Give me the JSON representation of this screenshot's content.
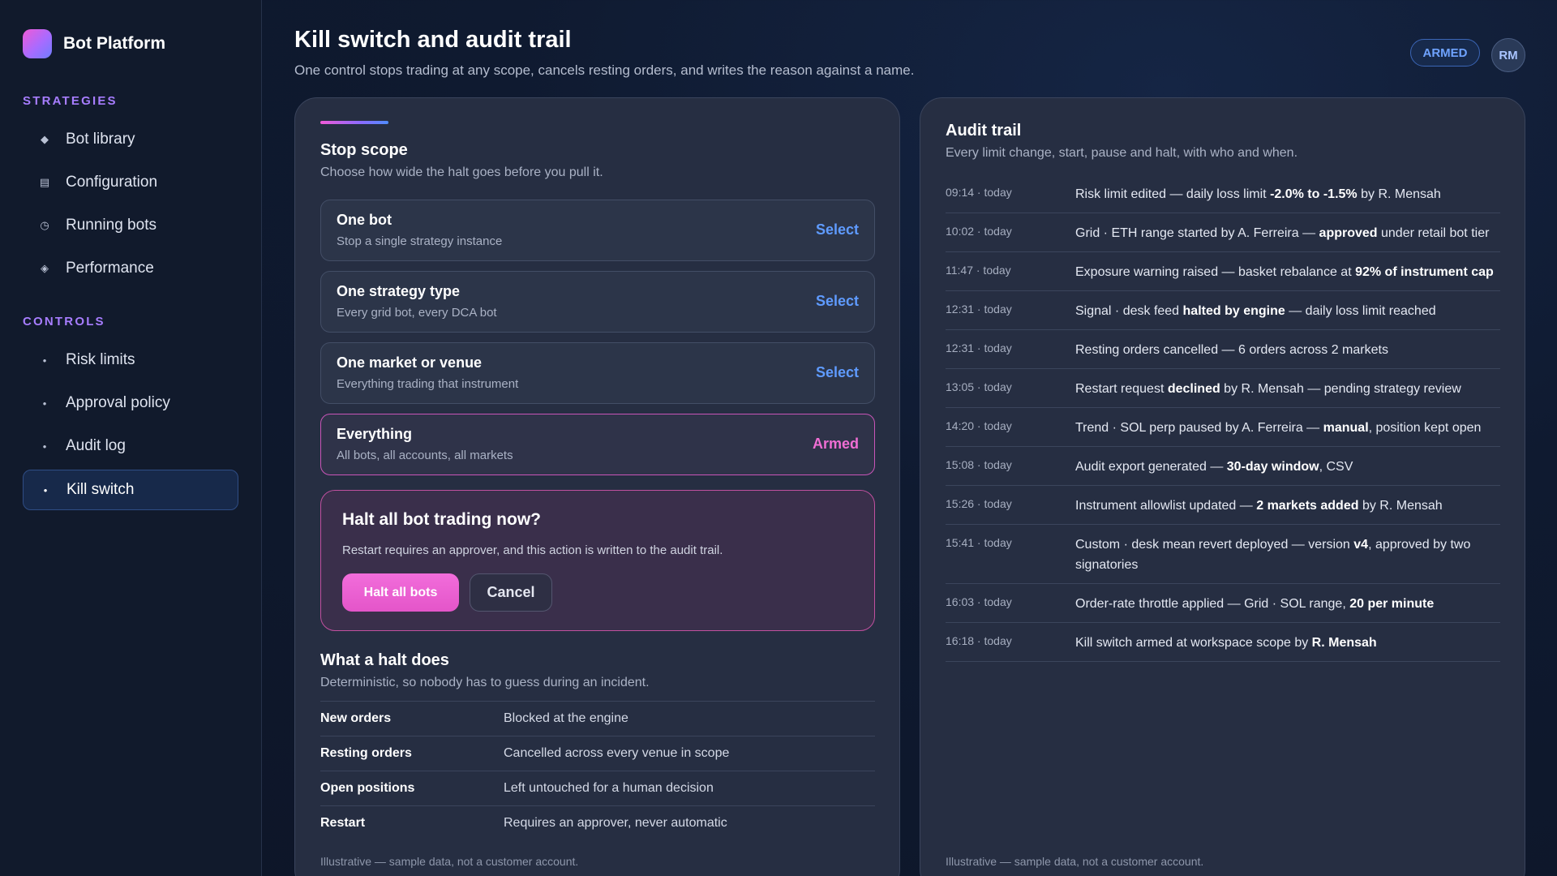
{
  "app": {
    "name": "Bot Platform"
  },
  "sidebar": {
    "sections": [
      {
        "title": "STRATEGIES",
        "items": [
          {
            "label": "Bot library",
            "icon": "diamond-icon",
            "glyph": "◆"
          },
          {
            "label": "Configuration",
            "icon": "list-icon",
            "glyph": "▤"
          },
          {
            "label": "Running bots",
            "icon": "clock-icon",
            "glyph": "◷"
          },
          {
            "label": "Performance",
            "icon": "chart-icon",
            "glyph": "◈"
          }
        ]
      },
      {
        "title": "CONTROLS",
        "items": [
          {
            "label": "Risk limits",
            "icon": "dot-icon",
            "glyph": "•"
          },
          {
            "label": "Approval policy",
            "icon": "dot-icon",
            "glyph": "•"
          },
          {
            "label": "Audit log",
            "icon": "dot-icon",
            "glyph": "•"
          },
          {
            "label": "Kill switch",
            "icon": "dot-icon",
            "glyph": "•",
            "active": true
          }
        ]
      }
    ]
  },
  "header": {
    "title": "Kill switch and audit trail",
    "subtitle": "One control stops trading at any scope, cancels resting orders, and writes the reason against a name.",
    "status_badge": "ARMED",
    "avatar_initials": "RM"
  },
  "stop_scope": {
    "title": "Stop scope",
    "subtitle": "Choose how wide the halt goes before you pull it.",
    "options": [
      {
        "title": "One bot",
        "desc": "Stop a single strategy instance",
        "action": "Select"
      },
      {
        "title": "One strategy type",
        "desc": "Every grid bot, every DCA bot",
        "action": "Select"
      },
      {
        "title": "One market or venue",
        "desc": "Everything trading that instrument",
        "action": "Select"
      },
      {
        "title": "Everything",
        "desc": "All bots, all accounts, all markets",
        "action": "Armed"
      }
    ]
  },
  "confirm": {
    "title": "Halt all bot trading now?",
    "text": "Restart requires an approver, and this action is written to the audit trail.",
    "halt_label": "Halt all bots",
    "cancel_label": "Cancel"
  },
  "halt_info": {
    "title": "What a halt does",
    "subtitle": "Deterministic, so nobody has to guess during an incident.",
    "rows": [
      {
        "key": "New orders",
        "value": "Blocked at the engine"
      },
      {
        "key": "Resting orders",
        "value": "Cancelled across every venue in scope"
      },
      {
        "key": "Open positions",
        "value": "Left untouched for a human decision"
      },
      {
        "key": "Restart",
        "value": "Requires an approver, never automatic"
      }
    ]
  },
  "audit": {
    "title": "Audit trail",
    "subtitle": "Every limit change, start, pause and halt, with who and when.",
    "entries": [
      {
        "time": "09:14 · today",
        "parts": [
          [
            "Risk limit edited — daily loss limit ",
            false
          ],
          [
            "-2.0% to -1.5%",
            true
          ],
          [
            " by R. Mensah",
            false
          ]
        ]
      },
      {
        "time": "10:02 · today",
        "parts": [
          [
            "Grid · ETH range started by A. Ferreira — ",
            false
          ],
          [
            "approved",
            true
          ],
          [
            " under retail bot tier",
            false
          ]
        ]
      },
      {
        "time": "11:47 · today",
        "parts": [
          [
            "Exposure warning raised — basket rebalance at ",
            false
          ],
          [
            "92% of instrument cap",
            true
          ]
        ]
      },
      {
        "time": "12:31 · today",
        "parts": [
          [
            "Signal · desk feed ",
            false
          ],
          [
            "halted by engine",
            true
          ],
          [
            " — daily loss limit reached",
            false
          ]
        ]
      },
      {
        "time": "12:31 · today",
        "parts": [
          [
            "Resting orders cancelled — 6 orders across 2 markets",
            false
          ]
        ]
      },
      {
        "time": "13:05 · today",
        "parts": [
          [
            "Restart request ",
            false
          ],
          [
            "declined",
            true
          ],
          [
            " by R. Mensah — pending strategy review",
            false
          ]
        ]
      },
      {
        "time": "14:20 · today",
        "parts": [
          [
            "Trend · SOL perp paused by A. Ferreira — ",
            false
          ],
          [
            "manual",
            true
          ],
          [
            ", position kept open",
            false
          ]
        ]
      },
      {
        "time": "15:08 · today",
        "parts": [
          [
            "Audit export generated — ",
            false
          ],
          [
            "30-day window",
            true
          ],
          [
            ", CSV",
            false
          ]
        ]
      },
      {
        "time": "15:26 · today",
        "parts": [
          [
            "Instrument allowlist updated — ",
            false
          ],
          [
            "2 markets added",
            true
          ],
          [
            " by R. Mensah",
            false
          ]
        ]
      },
      {
        "time": "15:41 · today",
        "parts": [
          [
            "Custom · desk mean revert deployed — version ",
            false
          ],
          [
            "v4",
            true
          ],
          [
            ", approved by two signatories",
            false
          ]
        ]
      },
      {
        "time": "16:03 · today",
        "parts": [
          [
            "Order-rate throttle applied — Grid · SOL range, ",
            false
          ],
          [
            "20 per minute",
            true
          ]
        ]
      },
      {
        "time": "16:18 · today",
        "parts": [
          [
            "Kill switch armed at workspace scope by ",
            false
          ],
          [
            "R. Mensah",
            true
          ]
        ]
      }
    ]
  },
  "footnote": "Illustrative — sample data, not a customer account."
}
